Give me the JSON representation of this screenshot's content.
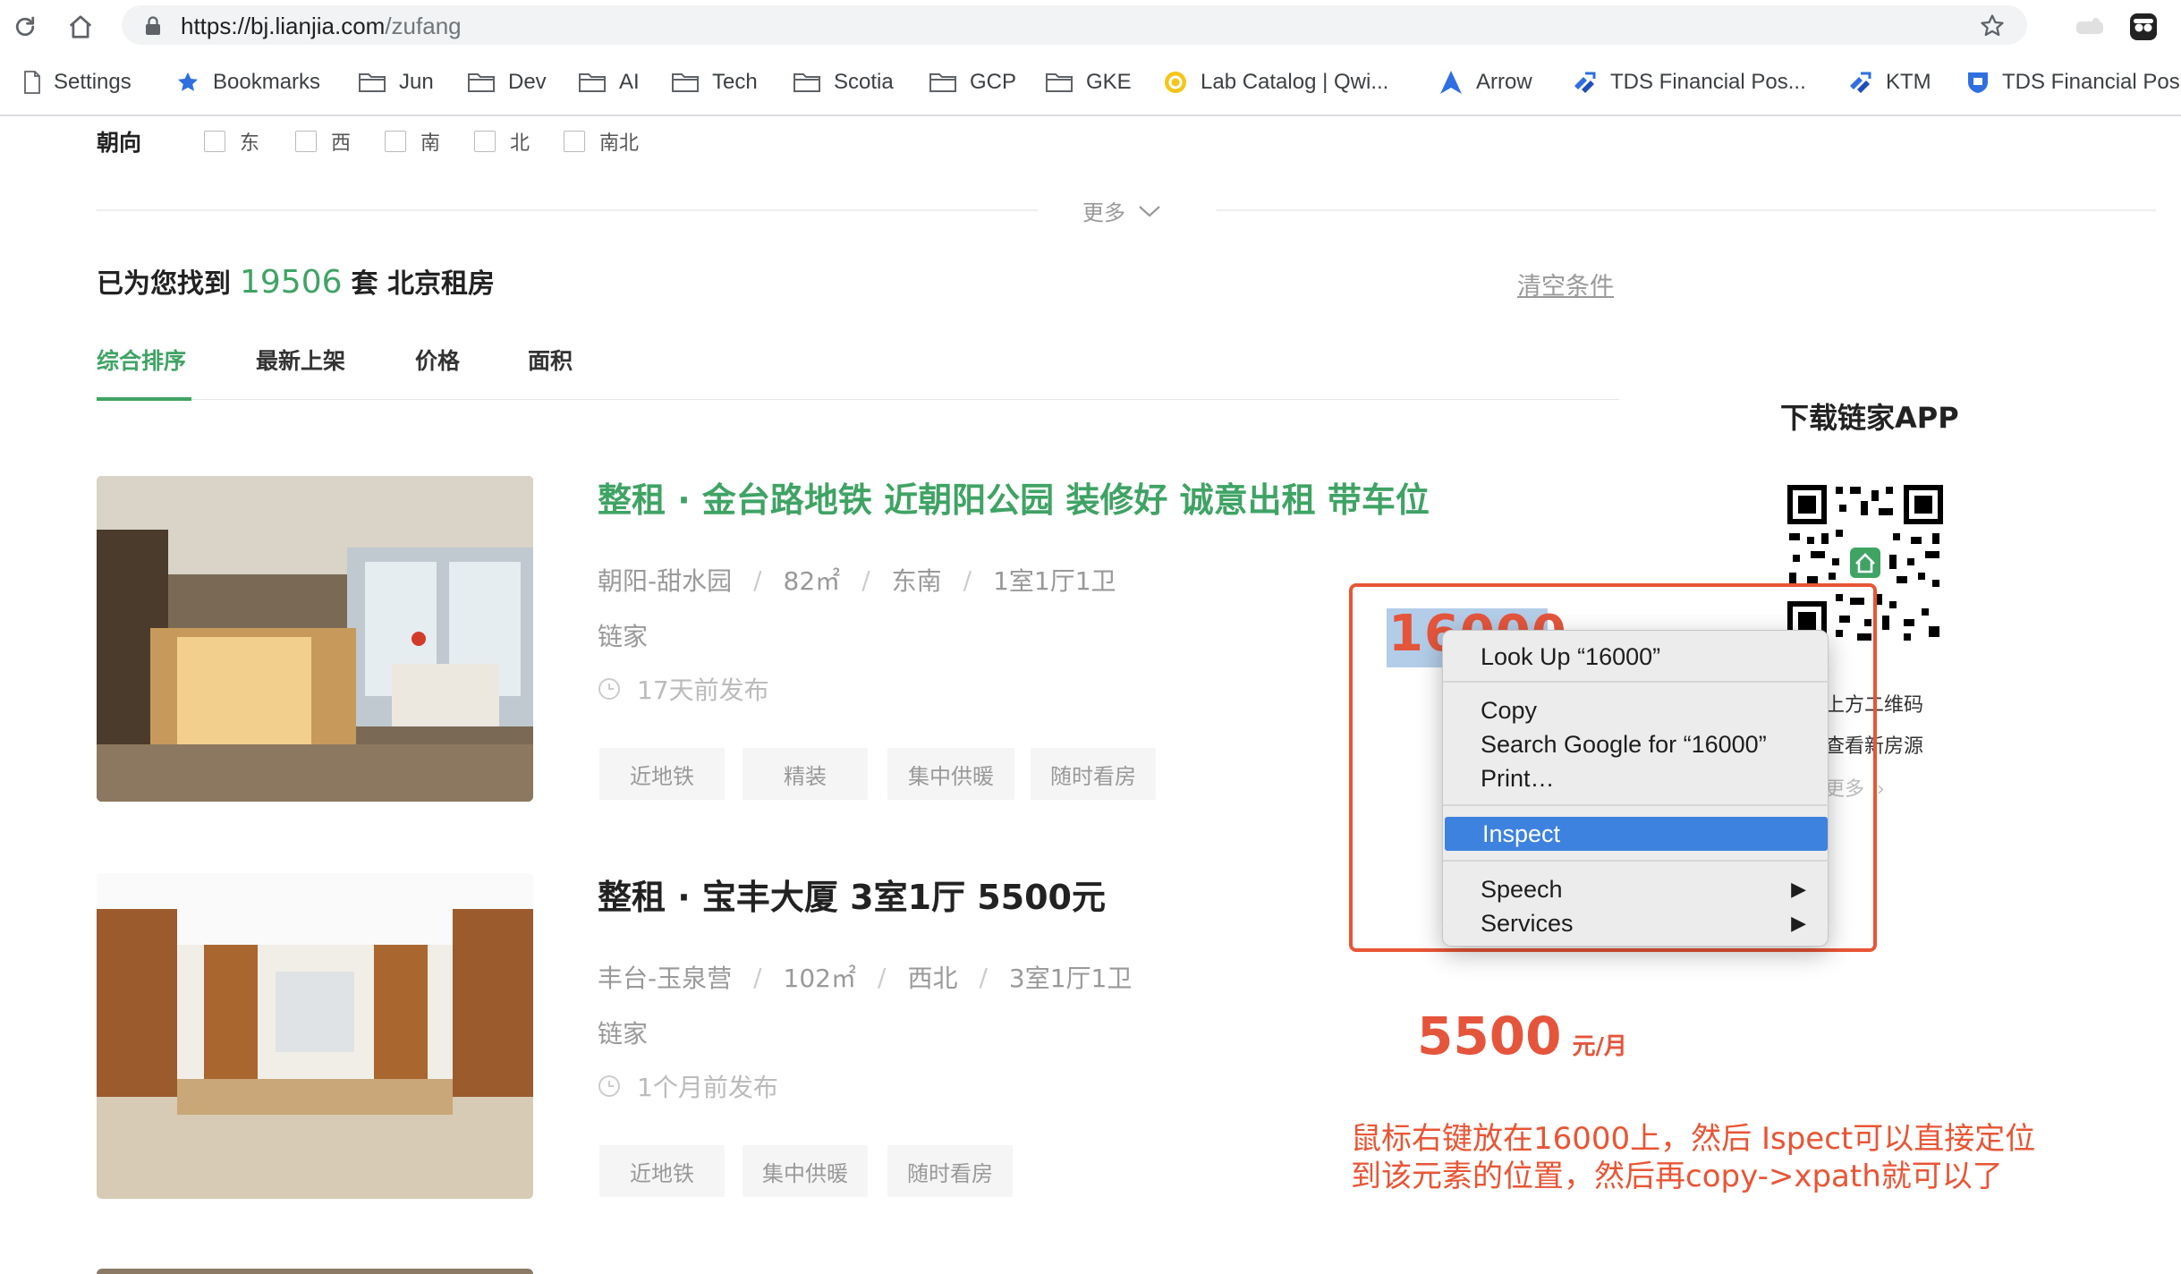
{
  "browser": {
    "url_host": "https://bj.lianjia.com",
    "url_path": "/zufang",
    "bookmarks": [
      "Settings",
      "Bookmarks",
      "Jun",
      "Dev",
      "AI",
      "Tech",
      "Scotia",
      "GCP",
      "GKE",
      "Lab Catalog | Qwi...",
      "Arrow",
      "TDS Financial Pos...",
      "KTM",
      "TDS Financial Pos"
    ]
  },
  "filters": {
    "orientation_label": "朝向",
    "options": [
      "东",
      "西",
      "南",
      "北",
      "南北"
    ],
    "more_label": "更多"
  },
  "results": {
    "prefix": "已为您找到",
    "count": "19506",
    "suffix": "套 北京租房",
    "clear_label": "清空条件"
  },
  "sort_tabs": [
    "综合排序",
    "最新上架",
    "价格",
    "面积"
  ],
  "listings": [
    {
      "title": "整租 · 金台路地铁 近朝阳公园 装修好 诚意出租 带车位",
      "district": "朝阳-甜水园",
      "area": "82㎡",
      "orientation": "东南",
      "layout": "1室1厅1卫",
      "brand": "链家",
      "time": "17天前发布",
      "tags": [
        "近地铁",
        "精装",
        "集中供暖",
        "随时看房"
      ],
      "price": "16000"
    },
    {
      "title": "整租 · 宝丰大厦 3室1厅 5500元",
      "district": "丰台-玉泉营",
      "area": "102㎡",
      "orientation": "西北",
      "layout": "3室1厅1卫",
      "brand": "链家",
      "time": "1个月前发布",
      "tags": [
        "近地铁",
        "集中供暖",
        "随时看房"
      ],
      "price": "5500",
      "price_unit": "元/月"
    }
  ],
  "app_promo": {
    "title": "下载链家APP",
    "line1": "上方二维码",
    "line2": "查看新房源",
    "more": "更多"
  },
  "context_menu": {
    "items": [
      "Look Up “16000”",
      "Copy",
      "Search Google for “16000”",
      "Print…",
      "Inspect",
      "Speech",
      "Services"
    ],
    "selected": "Inspect"
  },
  "annotation": {
    "line1": "鼠标右键放在16000上，然后 Ispect可以直接定位",
    "line2": "到该元素的位置，然后再copy->xpath就可以了"
  },
  "colors": {
    "accent_green": "#3fa364",
    "price_red": "#e4553c",
    "annotation_red": "#e85535",
    "menu_highlight": "#3d82de"
  }
}
